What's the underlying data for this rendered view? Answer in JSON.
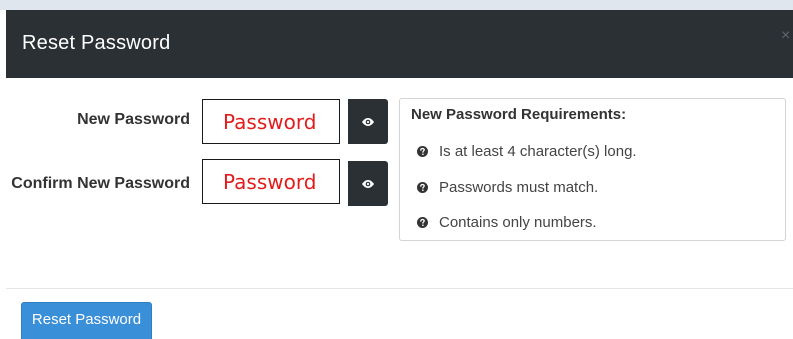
{
  "dialog": {
    "title": "Reset Password",
    "close_icon": "close-icon"
  },
  "form": {
    "new_password": {
      "label": "New Password",
      "placeholder": "Password",
      "reveal_icon": "eye-icon"
    },
    "confirm_password": {
      "label": "Confirm New Password",
      "placeholder": "Password",
      "reveal_icon": "eye-icon"
    }
  },
  "requirements": {
    "title": "New Password Requirements:",
    "item_icon": "question-circle-icon",
    "items": [
      "Is at least 4 character(s) long.",
      "Passwords must match.",
      "Contains only numbers."
    ]
  },
  "footer": {
    "submit_label": "Reset Password"
  },
  "colors": {
    "header_bg": "#2b3034",
    "primary_button": "#3a8fd9",
    "placeholder_text": "#e21c1c"
  }
}
